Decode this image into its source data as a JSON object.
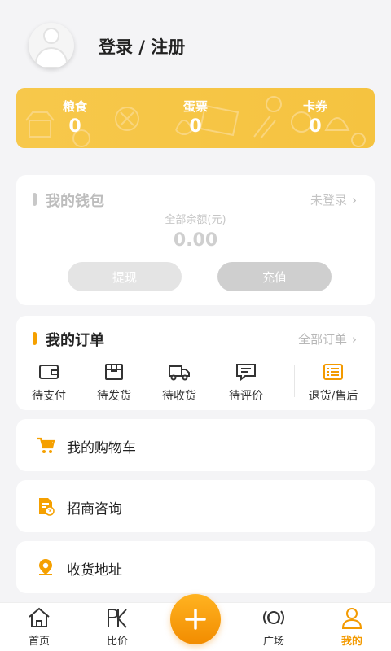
{
  "profile": {
    "login_label": "登录 / 注册"
  },
  "points": {
    "grain": {
      "label": "粮食",
      "value": "0"
    },
    "egg_ticket": {
      "label": "蛋票",
      "value": "0"
    },
    "coupon": {
      "label": "卡券",
      "value": "0"
    }
  },
  "wallet": {
    "title": "我的钱包",
    "status": "未登录",
    "balance_label": "全部余额(元)",
    "balance_value": "0.00",
    "withdraw_label": "提现",
    "recharge_label": "充值"
  },
  "orders": {
    "title": "我的订单",
    "all_label": "全部订单",
    "items": [
      {
        "label": "待支付",
        "icon": "wallet-icon"
      },
      {
        "label": "待发货",
        "icon": "package-icon"
      },
      {
        "label": "待收货",
        "icon": "truck-icon"
      },
      {
        "label": "待评价",
        "icon": "comment-icon"
      },
      {
        "label": "退货/售后",
        "icon": "return-list-icon"
      }
    ]
  },
  "menu": {
    "cart": "我的购物车",
    "merchant": "招商咨询",
    "address": "收货地址"
  },
  "tabbar": {
    "home": "首页",
    "compare": "比价",
    "square": "广场",
    "mine": "我的"
  },
  "colors": {
    "accent": "#f5a000",
    "card_yellow": "#f6c545",
    "tab_active": "#f39a00"
  }
}
